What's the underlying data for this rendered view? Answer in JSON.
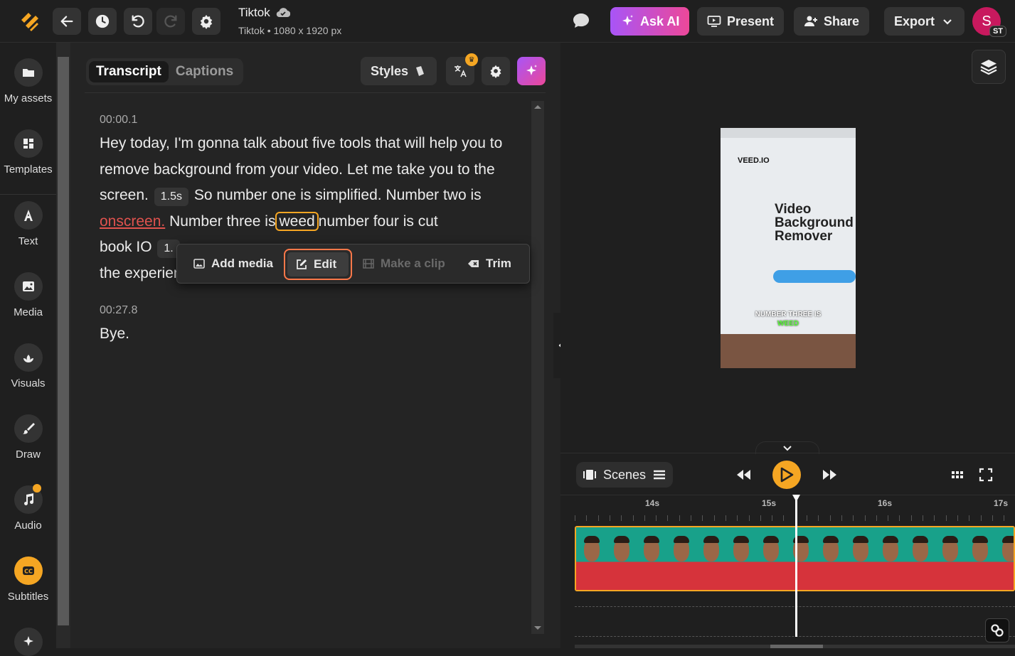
{
  "topbar": {
    "project_title": "Tiktok",
    "project_subtitle": "Tiktok • 1080 x 1920 px",
    "ask_ai": "Ask AI",
    "present": "Present",
    "share": "Share",
    "export": "Export",
    "avatar_initial": "S",
    "avatar_badge": "ST"
  },
  "sidebar": {
    "items": [
      {
        "label": "My assets",
        "icon": "folder-icon"
      },
      {
        "label": "Templates",
        "icon": "templates-icon"
      },
      {
        "label": "Text",
        "icon": "text-icon"
      },
      {
        "label": "Media",
        "icon": "image-icon"
      },
      {
        "label": "Visuals",
        "icon": "visuals-icon"
      },
      {
        "label": "Draw",
        "icon": "brush-icon"
      },
      {
        "label": "Audio",
        "icon": "music-icon"
      },
      {
        "label": "Subtitles",
        "icon": "cc-icon"
      }
    ]
  },
  "panel": {
    "tabs": [
      "Transcript",
      "Captions"
    ],
    "active_tab": "Transcript",
    "styles_label": "Styles"
  },
  "transcript": {
    "blocks": [
      {
        "timestamp": "00:00.1",
        "p1": "Hey today, I'm gonna talk about five tools that will help you to remove background from your video. Let me take you to the screen.",
        "chip1": "1.5s",
        "p2": "So number one is simplified. Number two is",
        "selected": "onscreen.",
        "p3": "Number three is",
        "boxed": "weed",
        "p4": "number four is cut",
        "p5": "book IO",
        "chip2": "1.",
        "p6": "the experience?"
      },
      {
        "timestamp": "00:27.8",
        "text": "Bye."
      }
    ]
  },
  "popup": {
    "add_media": "Add media",
    "edit": "Edit",
    "make_clip": "Make a clip",
    "trim": "Trim"
  },
  "preview": {
    "logo_text": "VEED.IO",
    "headline": "Video Background Remover",
    "caption_line1": "NUMBER THREE IS",
    "caption_line2": "WEED"
  },
  "timeline": {
    "scenes_label": "Scenes",
    "ticks": [
      "14s",
      "15s",
      "16s",
      "17s"
    ]
  },
  "colors": {
    "accent": "#f5a623",
    "ask_ai_start": "#a855f7",
    "ask_ai_end": "#ec4899",
    "selection": "#e0524e",
    "edit_outline": "#ff7849"
  }
}
